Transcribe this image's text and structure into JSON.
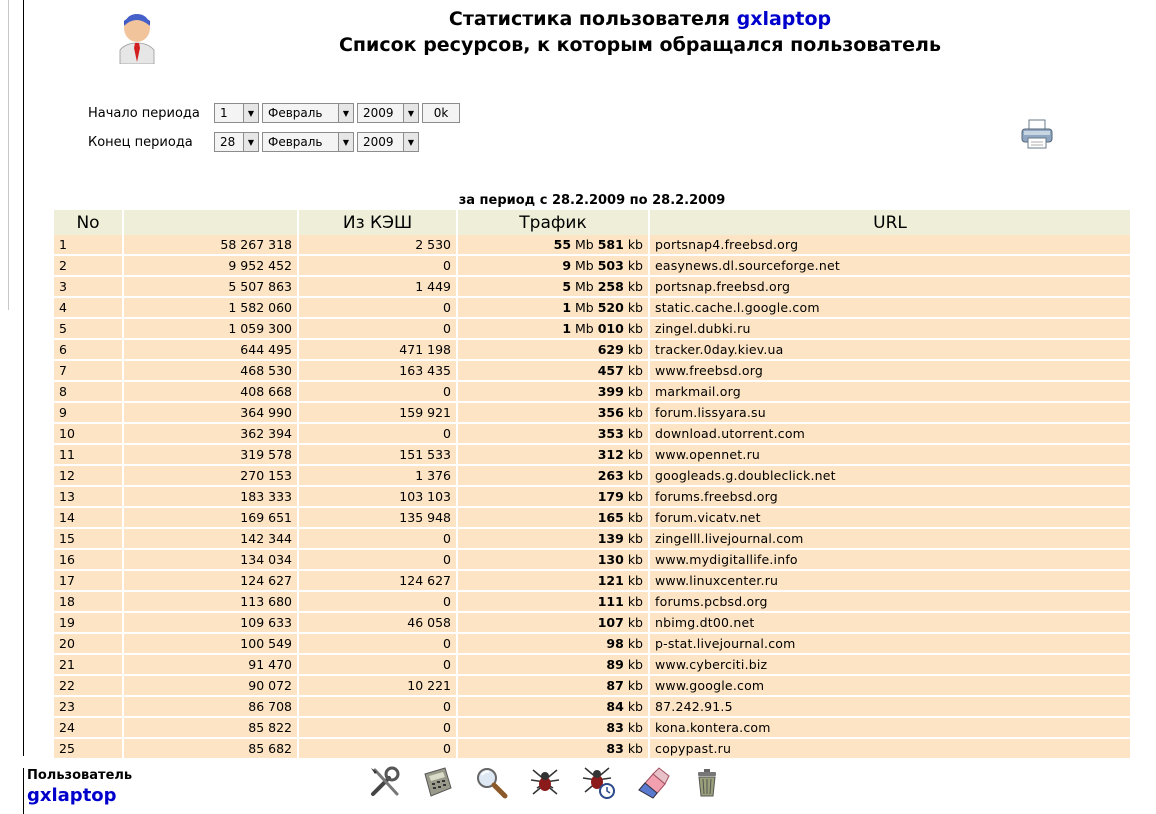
{
  "header": {
    "title_prefix": "Статистика пользователя",
    "username": "gxlaptop",
    "subtitle": "Список ресурсов, к которым обращался пользователь"
  },
  "period": {
    "start_label": "Начало периода",
    "end_label": "Конец периода",
    "start_day": "1",
    "start_month": "Февраль",
    "start_year": "2009",
    "end_day": "28",
    "end_month": "Февраль",
    "end_year": "2009",
    "ok_label": "0k"
  },
  "report": {
    "caption": "за период с 28.2.2009 по 28.2.2009",
    "columns": [
      "No",
      "",
      "Из КЭШ",
      "Трафик",
      "URL"
    ],
    "rows": [
      {
        "no": "1",
        "bytes": "58 267 318",
        "cache": "2 530",
        "mb": "55",
        "kb": "581",
        "url": "portsnap4.freebsd.org"
      },
      {
        "no": "2",
        "bytes": "9 952 452",
        "cache": "0",
        "mb": "9",
        "kb": "503",
        "url": "easynews.dl.sourceforge.net"
      },
      {
        "no": "3",
        "bytes": "5 507 863",
        "cache": "1 449",
        "mb": "5",
        "kb": "258",
        "url": "portsnap.freebsd.org"
      },
      {
        "no": "4",
        "bytes": "1 582 060",
        "cache": "0",
        "mb": "1",
        "kb": "520",
        "url": "static.cache.l.google.com"
      },
      {
        "no": "5",
        "bytes": "1 059 300",
        "cache": "0",
        "mb": "1",
        "kb": "010",
        "url": "zingel.dubki.ru"
      },
      {
        "no": "6",
        "bytes": "644 495",
        "cache": "471 198",
        "mb": "",
        "kb": "629",
        "url": "tracker.0day.kiev.ua"
      },
      {
        "no": "7",
        "bytes": "468 530",
        "cache": "163 435",
        "mb": "",
        "kb": "457",
        "url": "www.freebsd.org"
      },
      {
        "no": "8",
        "bytes": "408 668",
        "cache": "0",
        "mb": "",
        "kb": "399",
        "url": "markmail.org"
      },
      {
        "no": "9",
        "bytes": "364 990",
        "cache": "159 921",
        "mb": "",
        "kb": "356",
        "url": "forum.lissyara.su"
      },
      {
        "no": "10",
        "bytes": "362 394",
        "cache": "0",
        "mb": "",
        "kb": "353",
        "url": "download.utorrent.com"
      },
      {
        "no": "11",
        "bytes": "319 578",
        "cache": "151 533",
        "mb": "",
        "kb": "312",
        "url": "www.opennet.ru"
      },
      {
        "no": "12",
        "bytes": "270 153",
        "cache": "1 376",
        "mb": "",
        "kb": "263",
        "url": "googleads.g.doubleclick.net"
      },
      {
        "no": "13",
        "bytes": "183 333",
        "cache": "103 103",
        "mb": "",
        "kb": "179",
        "url": "forums.freebsd.org"
      },
      {
        "no": "14",
        "bytes": "169 651",
        "cache": "135 948",
        "mb": "",
        "kb": "165",
        "url": "forum.vicatv.net"
      },
      {
        "no": "15",
        "bytes": "142 344",
        "cache": "0",
        "mb": "",
        "kb": "139",
        "url": "zingelll.livejournal.com"
      },
      {
        "no": "16",
        "bytes": "134 034",
        "cache": "0",
        "mb": "",
        "kb": "130",
        "url": "www.mydigitallife.info"
      },
      {
        "no": "17",
        "bytes": "124 627",
        "cache": "124 627",
        "mb": "",
        "kb": "121",
        "url": "www.linuxcenter.ru"
      },
      {
        "no": "18",
        "bytes": "113 680",
        "cache": "0",
        "mb": "",
        "kb": "111",
        "url": "forums.pcbsd.org"
      },
      {
        "no": "19",
        "bytes": "109 633",
        "cache": "46 058",
        "mb": "",
        "kb": "107",
        "url": "nbimg.dt00.net"
      },
      {
        "no": "20",
        "bytes": "100 549",
        "cache": "0",
        "mb": "",
        "kb": "98",
        "url": "p-stat.livejournal.com"
      },
      {
        "no": "21",
        "bytes": "91 470",
        "cache": "0",
        "mb": "",
        "kb": "89",
        "url": "www.cyberciti.biz"
      },
      {
        "no": "22",
        "bytes": "90 072",
        "cache": "10 221",
        "mb": "",
        "kb": "87",
        "url": "www.google.com"
      },
      {
        "no": "23",
        "bytes": "86 708",
        "cache": "0",
        "mb": "",
        "kb": "84",
        "url": "87.242.91.5"
      },
      {
        "no": "24",
        "bytes": "85 822",
        "cache": "0",
        "mb": "",
        "kb": "83",
        "url": "kona.kontera.com"
      },
      {
        "no": "25",
        "bytes": "85 682",
        "cache": "0",
        "mb": "",
        "kb": "83",
        "url": "copypast.ru"
      }
    ],
    "unit_mb": "Mb",
    "unit_kb": "kb"
  },
  "footer": {
    "user_label": "Пользователь",
    "username": "gxlaptop"
  },
  "toolbar": {
    "tools": [
      "tools-icon",
      "calculator-icon",
      "search-icon",
      "spider-icon",
      "spider-clock-icon",
      "eraser-icon",
      "trash-icon"
    ]
  },
  "colors": {
    "link": "#0000cc",
    "row_bg": "#fde4c4",
    "header_bg": "#efefd9"
  }
}
